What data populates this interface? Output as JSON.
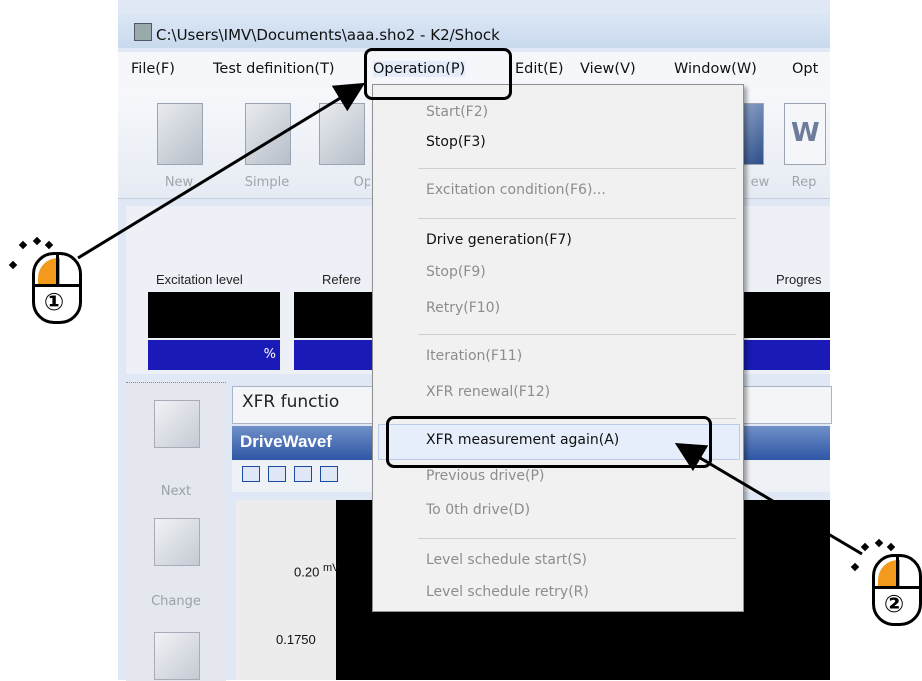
{
  "window": {
    "title": "C:\\Users\\IMV\\Documents\\aaa.sho2 - K2/Shock"
  },
  "menubar": {
    "items": [
      {
        "label": "File(F)"
      },
      {
        "label": "Test definition(T)"
      },
      {
        "label": "Operation(P)"
      },
      {
        "label": "Edit(E)"
      },
      {
        "label": "View(V)"
      },
      {
        "label": "Window(W)"
      },
      {
        "label": "Opt"
      }
    ]
  },
  "toolbar": {
    "buttons": [
      {
        "label": "New"
      },
      {
        "label": "Simple"
      },
      {
        "label": "Op"
      },
      {
        "label": "ew"
      },
      {
        "label": "Rep"
      }
    ]
  },
  "status": {
    "excitation_level_label": "Excitation level",
    "reference_label": "Refere",
    "progress_label": "Progres",
    "excitation_unit": "%"
  },
  "leftnav": {
    "items": [
      {
        "label": "Next"
      },
      {
        "label": "Change"
      },
      {
        "label": ""
      }
    ]
  },
  "xfr_tab": {
    "title": "XFR functio"
  },
  "drive_window": {
    "title": "DriveWavef"
  },
  "chart": {
    "ticks": [
      {
        "value": "0.20",
        "unit": "mV"
      },
      {
        "value": "0.1750",
        "unit": ""
      }
    ]
  },
  "dropdown": {
    "items": [
      {
        "label": "Start(F2)",
        "enabled": false
      },
      {
        "label": "Stop(F3)",
        "enabled": true
      },
      {
        "label": "Excitation condition(F6)...",
        "enabled": false
      },
      {
        "label": "Drive generation(F7)",
        "enabled": true
      },
      {
        "label": "Stop(F9)",
        "enabled": false
      },
      {
        "label": "Retry(F10)",
        "enabled": false
      },
      {
        "label": "Iteration(F11)",
        "enabled": false
      },
      {
        "label": "XFR renewal(F12)",
        "enabled": false
      },
      {
        "label": "XFR measurement again(A)",
        "enabled": true
      },
      {
        "label": "Previous drive(P)",
        "enabled": false
      },
      {
        "label": "To 0th drive(D)",
        "enabled": false
      },
      {
        "label": "Level schedule start(S)",
        "enabled": false
      },
      {
        "label": "Level schedule retry(R)",
        "enabled": false
      }
    ]
  },
  "annotations": {
    "step1": "①",
    "step2": "②"
  },
  "colors": {
    "mouse_button": "#f39a1c",
    "status_blue": "#1a1ab8",
    "header_blue": "#2f57a6"
  }
}
